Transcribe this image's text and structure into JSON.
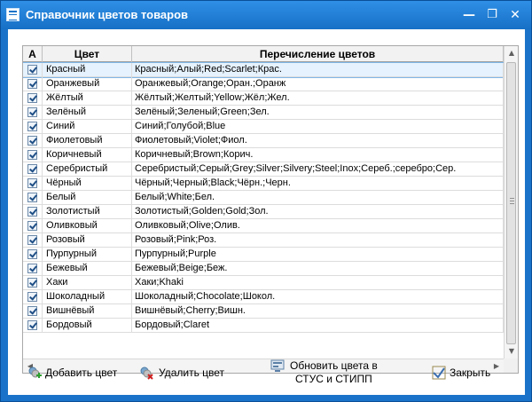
{
  "window": {
    "title": "Справочник цветов товаров",
    "minimize_glyph": "—",
    "restore_glyph": "❐",
    "close_glyph": "✕"
  },
  "grid": {
    "columns": [
      "A",
      "Цвет",
      "Перечисление цветов"
    ],
    "rows": [
      {
        "checked": true,
        "name": "Красный",
        "list": "Красный;Алый;Red;Scarlet;Крас."
      },
      {
        "checked": true,
        "name": "Оранжевый",
        "list": "Оранжевый;Orange;Оран.;Оранж"
      },
      {
        "checked": true,
        "name": "Жёлтый",
        "list": "Жёлтый;Желтый;Yellow;Жёл;Жел."
      },
      {
        "checked": true,
        "name": "Зелёный",
        "list": "Зелёный;Зеленый;Green;Зел."
      },
      {
        "checked": true,
        "name": "Синий",
        "list": "Синий;Голубой;Blue"
      },
      {
        "checked": true,
        "name": "Фиолетовый",
        "list": "Фиолетовый;Violet;Фиол."
      },
      {
        "checked": true,
        "name": "Коричневый",
        "list": "Коричневый;Brown;Корич."
      },
      {
        "checked": true,
        "name": "Серебристый",
        "list": "Серебристый;Серый;Grey;Silver;Silvery;Steel;Inox;Сереб.;серебро;Сер."
      },
      {
        "checked": true,
        "name": "Чёрный",
        "list": "Чёрный;Черный;Black;Чёрн.;Черн."
      },
      {
        "checked": true,
        "name": "Белый",
        "list": "Белый;White;Бел."
      },
      {
        "checked": true,
        "name": "Золотистый",
        "list": "Золотистый;Golden;Gold;Зол."
      },
      {
        "checked": true,
        "name": "Оливковый",
        "list": "Оливковый;Olive;Олив."
      },
      {
        "checked": true,
        "name": "Розовый",
        "list": "Розовый;Pink;Роз."
      },
      {
        "checked": true,
        "name": "Пурпурный",
        "list": "Пурпурный;Purple"
      },
      {
        "checked": true,
        "name": "Бежевый",
        "list": "Бежевый;Beige;Беж."
      },
      {
        "checked": true,
        "name": "Хаки",
        "list": "Хаки;Khaki"
      },
      {
        "checked": true,
        "name": "Шоколадный",
        "list": "Шоколадный;Chocolate;Шокол."
      },
      {
        "checked": true,
        "name": "Вишнёвый",
        "list": "Вишнёвый;Cherry;Вишн."
      },
      {
        "checked": true,
        "name": "Бордовый",
        "list": "Бордовый;Claret"
      }
    ]
  },
  "buttons": {
    "add": "Добавить цвет",
    "delete": "Удалить цвет",
    "update_line1": "Обновить цвета в",
    "update_line2": "СТУС и СТИПП",
    "close": "Закрыть"
  },
  "colors": {
    "title_bar": "#1a73c8",
    "selected_row": "#e6f2fd"
  }
}
